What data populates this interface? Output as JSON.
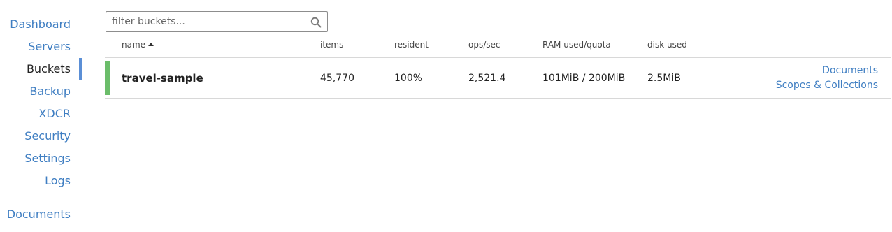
{
  "sidebar": {
    "items": [
      {
        "label": "Dashboard"
      },
      {
        "label": "Servers"
      },
      {
        "label": "Buckets"
      },
      {
        "label": "Backup"
      },
      {
        "label": "XDCR"
      },
      {
        "label": "Security"
      },
      {
        "label": "Settings"
      },
      {
        "label": "Logs"
      },
      {
        "label": "Documents"
      }
    ],
    "active": "Buckets"
  },
  "filter": {
    "placeholder": "filter buckets...",
    "value": "",
    "icon": "search-icon"
  },
  "table": {
    "headers": {
      "name": "name",
      "items": "items",
      "resident": "resident",
      "ops": "ops/sec",
      "ram": "RAM used/quota",
      "disk": "disk used"
    },
    "sort": {
      "column": "name",
      "direction": "ascending"
    },
    "rows": [
      {
        "name": "travel-sample",
        "items": "45,770",
        "resident": "100%",
        "ops": "2,521.4",
        "ram": "101MiB / 200MiB",
        "disk": "2.5MiB",
        "links": {
          "documents": "Documents",
          "scopes": "Scopes & Collections"
        },
        "status": "healthy"
      }
    ]
  },
  "colors": {
    "link": "#3f7ec2",
    "active_indicator": "#5b8fd6",
    "status_healthy": "#6bbd6a"
  }
}
